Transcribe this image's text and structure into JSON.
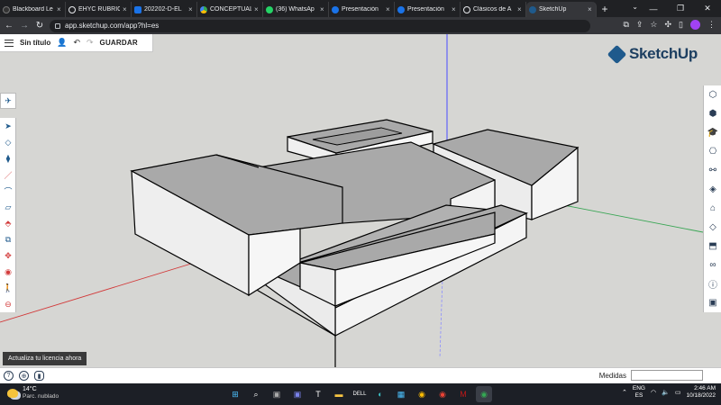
{
  "browser": {
    "tabs": [
      {
        "label": "Blackboard Le",
        "icon": "blackboard-icon",
        "color": "#333333",
        "active": false
      },
      {
        "label": "EHYC RÚBRIC",
        "icon": "globe-icon",
        "color": "#e8eaed",
        "active": false
      },
      {
        "label": "202202-D-EL",
        "icon": "meet-icon",
        "color": "#1a73e8",
        "active": false
      },
      {
        "label": "CONCEPTUAL",
        "icon": "drive-icon",
        "color": "#34a853",
        "active": false
      },
      {
        "label": "(36) WhatsAp",
        "icon": "whatsapp-icon",
        "color": "#25d366",
        "active": false
      },
      {
        "label": "Presentación",
        "icon": "canva-icon",
        "color": "#1a73e8",
        "active": false
      },
      {
        "label": "Presentación",
        "icon": "canva-icon",
        "color": "#1a73e8",
        "active": false
      },
      {
        "label": "Clásicos de A",
        "icon": "globe-icon",
        "color": "#e8eaed",
        "active": false
      },
      {
        "label": "SketchUp",
        "icon": "sketchup-icon",
        "color": "#1f5a8c",
        "active": true
      }
    ],
    "url": "app.sketchup.com/app?hl=es",
    "new_tab": "+"
  },
  "app": {
    "doc_title": "Sin título",
    "save_label": "GUARDAR",
    "logo_text": "SketchUp",
    "license_text": "Actualiza tu licencia ahora",
    "measure_label": "Medidas",
    "measure_value": ""
  },
  "left_tools": [
    "instructor-icon",
    "select-icon",
    "eraser-icon",
    "paint-bucket-icon",
    "line-icon",
    "arc-icon",
    "rectangle-icon",
    "push-pull-icon",
    "offset-icon",
    "move-icon",
    "tape-measure-icon",
    "walk-icon",
    "orbit-icon"
  ],
  "right_tools": [
    "entity-info-icon",
    "components-icon",
    "scenes-icon",
    "materials-icon",
    "outliner-icon",
    "styles-icon",
    "tags-icon",
    "display-icon",
    "views-icon",
    "glasses-icon",
    "info-icon",
    "solid-tools-icon"
  ],
  "taskbar": {
    "temperature": "14°C",
    "condition": "Parc. nublado",
    "lang_top": "ENG",
    "lang_bottom": "ES",
    "time": "2:46 AM",
    "date": "10/18/2022"
  },
  "colors": {
    "canvas": "#d6d6d3",
    "face_top": "#a9a9a9",
    "face_side": "#f1f1f1",
    "accent": "#1f5a8c"
  }
}
